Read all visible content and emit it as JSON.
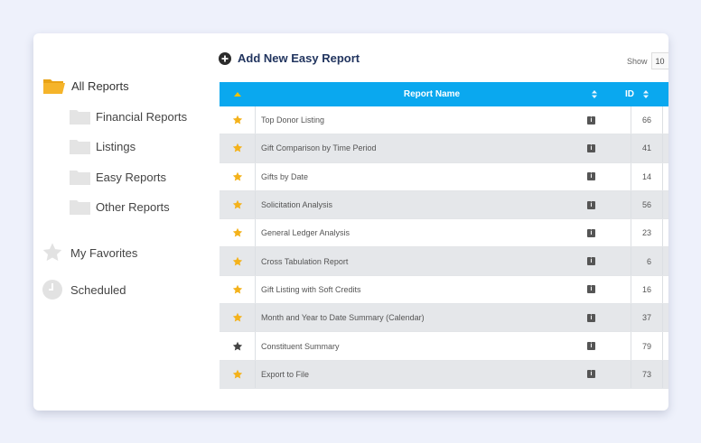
{
  "colors": {
    "accent": "#0aa8ef",
    "star_gold": "#f4b21b",
    "star_dark": "#444444",
    "title_navy": "#22355f",
    "folder_gold": "#f5b42a",
    "folder_gray": "#e4e4e4"
  },
  "sidebar": {
    "all_reports": {
      "label": "All Reports",
      "icon": "folder-open-icon"
    },
    "subfolders": [
      {
        "label": "Financial Reports",
        "icon": "folder-icon"
      },
      {
        "label": "Listings",
        "icon": "folder-icon"
      },
      {
        "label": "Easy Reports",
        "icon": "folder-icon"
      },
      {
        "label": "Other Reports",
        "icon": "folder-icon"
      }
    ],
    "favorites": {
      "label": "My  Favorites",
      "icon": "star-icon"
    },
    "scheduled": {
      "label": "Scheduled",
      "icon": "clock-icon"
    }
  },
  "header": {
    "add_label": "Add New Easy Report",
    "show_label": "Show",
    "show_value": "10"
  },
  "table": {
    "columns": {
      "name": "Report Name",
      "id": "ID"
    },
    "rows": [
      {
        "name": "Top Donor Listing",
        "id": "66",
        "favorite": true,
        "trail": ""
      },
      {
        "name": "Gift Comparison by Time Period",
        "id": "41",
        "favorite": true,
        "trail": ""
      },
      {
        "name": "Gifts by Date",
        "id": "14",
        "favorite": true,
        "trail": ""
      },
      {
        "name": "Solicitation Analysis",
        "id": "56",
        "favorite": true,
        "trail": ""
      },
      {
        "name": "General Ledger Analysis",
        "id": "23",
        "favorite": true,
        "trail": ""
      },
      {
        "name": "Cross Tabulation Report",
        "id": "6",
        "favorite": true,
        "trail": ""
      },
      {
        "name": "Gift Listing with Soft Credits",
        "id": "16",
        "favorite": true,
        "trail": ""
      },
      {
        "name": "Month and Year to Date Summary (Calendar)",
        "id": "37",
        "favorite": true,
        "trail": ""
      },
      {
        "name": "Constituent Summary",
        "id": "79",
        "favorite": false,
        "trail": ""
      },
      {
        "name": "Export to File",
        "id": "73",
        "favorite": true,
        "trail": ""
      }
    ]
  }
}
